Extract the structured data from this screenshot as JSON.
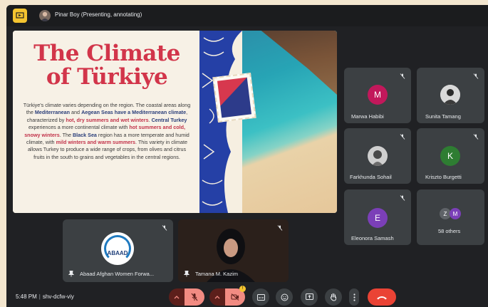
{
  "topbar": {
    "presenter_label": "Pinar Boy (Presenting, annotating)"
  },
  "slide": {
    "title_line1": "The Climate",
    "title_line2": "of Türkiye",
    "body": [
      {
        "t": "Türkiye's climate varies depending on the region. The coastal areas along the ",
        "s": "n"
      },
      {
        "t": "Mediterranean",
        "s": "b"
      },
      {
        "t": " and ",
        "s": "n"
      },
      {
        "t": "Aegean Seas have a Mediterranean climate",
        "s": "b"
      },
      {
        "t": ", characterized by ",
        "s": "n"
      },
      {
        "t": "hot, dry summers and wet winters",
        "s": "r"
      },
      {
        "t": ". ",
        "s": "n"
      },
      {
        "t": "Central Turkey",
        "s": "b"
      },
      {
        "t": " experiences a more continental climate with ",
        "s": "n"
      },
      {
        "t": "hot summers and cold, snowy winters",
        "s": "r"
      },
      {
        "t": ". The ",
        "s": "n"
      },
      {
        "t": "Black Sea",
        "s": "b"
      },
      {
        "t": " region has a more temperate and humid climate, with ",
        "s": "n"
      },
      {
        "t": "mild winters and warm summers",
        "s": "r"
      },
      {
        "t": ". This variety in climate allows Turkey to produce a wide range of crops, from olives and citrus fruits in the south to grains and vegetables in the central regions.",
        "s": "n"
      }
    ]
  },
  "participants": {
    "marwa": {
      "initial": "M",
      "name": "Marwa Habibi",
      "color": "#c2185b"
    },
    "sunita": {
      "name": "Sunita Tamang"
    },
    "farkhunda": {
      "name": "Farkhunda Sohail"
    },
    "kriszto": {
      "initial": "K",
      "name": "Kriszto Burgetti",
      "color": "#2e7d32"
    },
    "eleonora": {
      "initial": "E",
      "name": "Eleonora Samash",
      "color": "#7b3fb8"
    },
    "others": {
      "initials": [
        "Z",
        "M"
      ],
      "label": "58 others"
    }
  },
  "pinned": {
    "abaad": {
      "logo_text": "ABAAD",
      "name": "Abaad Afghan Women Forwa..."
    },
    "tamana": {
      "name": "Tamana M. Kazim"
    }
  },
  "bottombar": {
    "time": "5:48 PM",
    "meeting_code": "shv-dcfw-viy",
    "cam_badge": "!"
  }
}
